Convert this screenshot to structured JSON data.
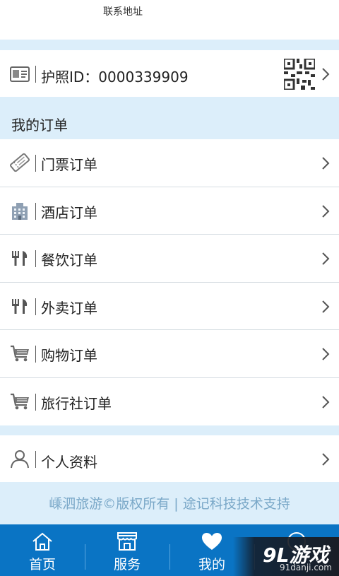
{
  "header": {
    "contact_label": "联系地址"
  },
  "passport": {
    "label": "护照ID：0000339909"
  },
  "orders": {
    "section_title": "我的订单",
    "items": [
      {
        "label": "门票订单",
        "icon": "ticket-icon"
      },
      {
        "label": "酒店订单",
        "icon": "hotel-icon"
      },
      {
        "label": "餐饮订单",
        "icon": "cutlery-icon"
      },
      {
        "label": "外卖订单",
        "icon": "cutlery-icon"
      },
      {
        "label": "购物订单",
        "icon": "cart-icon"
      },
      {
        "label": "旅行社订单",
        "icon": "cart-icon"
      }
    ]
  },
  "profile": {
    "label": "个人资料"
  },
  "footer": {
    "text": "嵊泗旅游©版权所有 | 途记科技技术支持"
  },
  "tabbar": {
    "tabs": [
      {
        "label": "首页",
        "icon": "home-icon"
      },
      {
        "label": "服务",
        "icon": "store-icon"
      },
      {
        "label": "我的",
        "icon": "heart-icon"
      },
      {
        "label": "",
        "icon": "clock-icon"
      }
    ]
  },
  "watermark": {
    "logo": "9L游戏",
    "site": "91danji.com"
  },
  "colors": {
    "accent": "#0a74c4",
    "background": "#dceefa",
    "footer_text": "#7aa8c8"
  }
}
